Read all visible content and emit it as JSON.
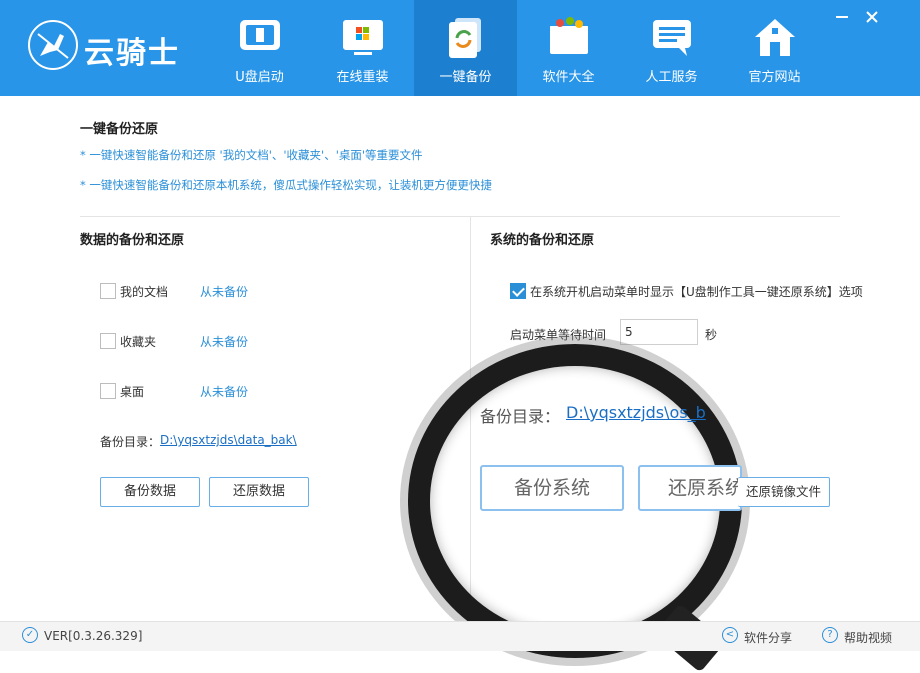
{
  "app": {
    "logo_text": "云骑士",
    "brand_color": "#2895e8",
    "minimize_icon": "minimize-icon",
    "close_icon": "close-icon"
  },
  "nav": [
    {
      "label": "U盘启动",
      "icon": "usb-drive-icon"
    },
    {
      "label": "在线重装",
      "icon": "windows-monitor-icon"
    },
    {
      "label": "一键备份",
      "icon": "backup-sync-icon",
      "active": true
    },
    {
      "label": "软件大全",
      "icon": "software-box-icon"
    },
    {
      "label": "人工服务",
      "icon": "chat-bubble-icon"
    },
    {
      "label": "官方网站",
      "icon": "home-icon"
    }
  ],
  "main": {
    "title": "一键备份还原",
    "tips": [
      "* 一键快速智能备份和还原 '我的文档'、'收藏夹'、'桌面'等重要文件",
      "* 一键快速智能备份和还原本机系统，傻瓜式操作轻松实现，让装机更方便更快捷"
    ]
  },
  "data_backup": {
    "title": "数据的备份和还原",
    "items": [
      {
        "label": "我的文档",
        "status": "从未备份",
        "checked": false
      },
      {
        "label": "收藏夹",
        "status": "从未备份",
        "checked": false
      },
      {
        "label": "桌面",
        "status": "从未备份",
        "checked": false
      }
    ],
    "dir_label": "备份目录：",
    "dir_path": "D:\\yqsxtzjds\\data_bak\\",
    "backup_button": "备份数据",
    "restore_button": "还原数据"
  },
  "system_backup": {
    "title": "系统的备份和还原",
    "boot_option": "在系统开机启动菜单时显示【U盘制作工具一键还原系统】选项",
    "boot_checked": true,
    "wait_label": "启动菜单等待时间",
    "wait_value": "5",
    "wait_unit": "秒",
    "dir_label": "备份目录：",
    "dir_path": "D:\\yqsxtzjds\\os_b",
    "backup_button": "备份系统",
    "restore_button": "还原系统",
    "restore_image_button": "还原镜像文件"
  },
  "footer": {
    "version": "VER[0.3.26.329]",
    "share": "软件分享",
    "help": "帮助视频"
  }
}
